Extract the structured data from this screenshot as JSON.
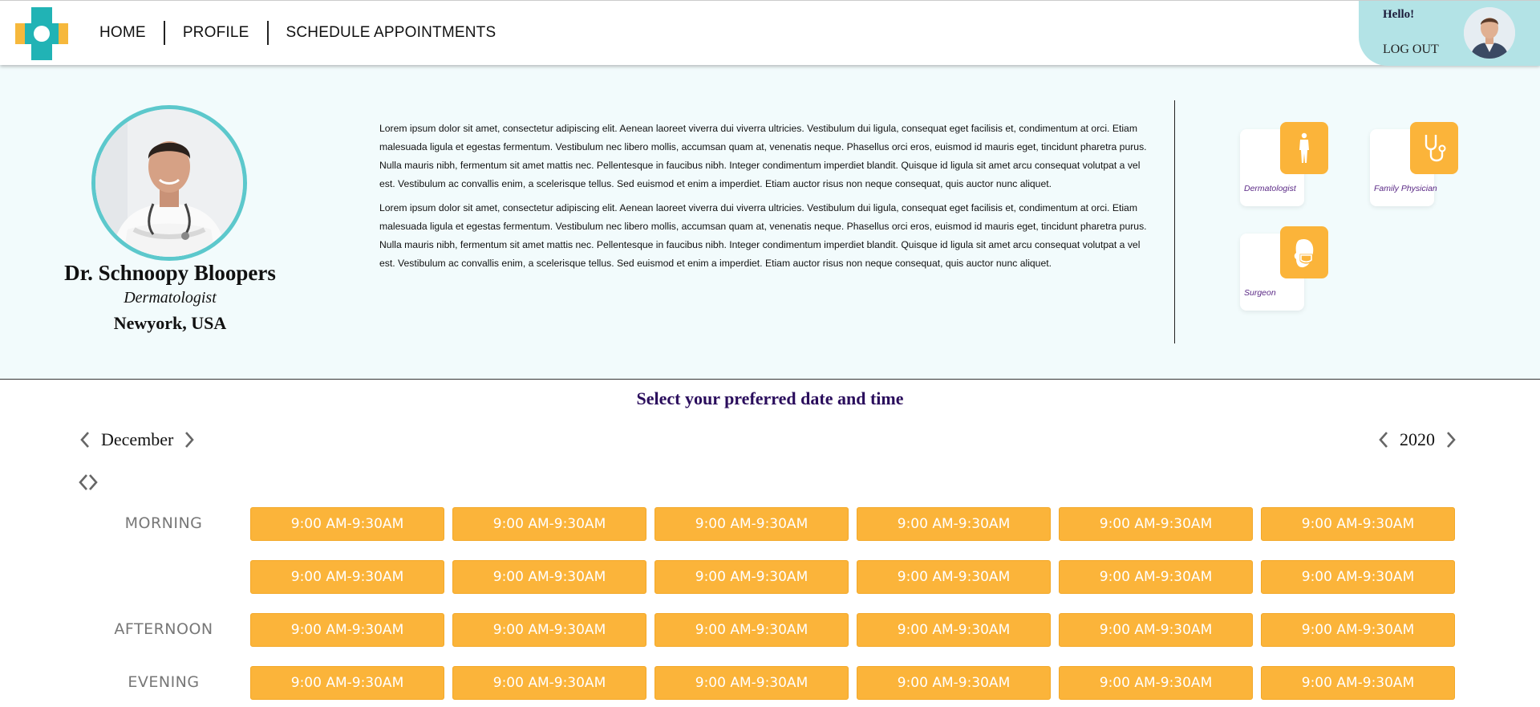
{
  "nav": {
    "links": [
      "HOME",
      "PROFILE",
      "SCHEDULE APPOINTMENTS"
    ]
  },
  "user": {
    "greeting": "Hello!",
    "logout_label": "LOG OUT"
  },
  "doctor": {
    "name": "Dr. Schnoopy Bloopers",
    "specialty": "Dermatologist",
    "location": "Newyork, USA"
  },
  "bio": {
    "paragraphs": [
      "Lorem ipsum dolor sit amet, consectetur adipiscing elit. Aenean laoreet viverra dui viverra ultricies. Vestibulum dui ligula, consequat eget facilisis et, condimentum at orci. Etiam malesuada ligula et egestas fermentum. Vestibulum nec libero mollis, accumsan quam at, venenatis neque. Phasellus orci eros, euismod id mauris eget, tincidunt pharetra purus. Nulla mauris nibh, fermentum sit amet mattis nec. Pellentesque in faucibus nibh. Integer condimentum imperdiet blandit. Quisque id ligula sit amet arcu consequat volutpat a vel est. Vestibulum ac convallis enim, a scelerisque tellus. Sed euismod et enim a imperdiet. Etiam auctor risus non neque consequat, quis auctor nunc aliquet.",
      "Lorem ipsum dolor sit amet, consectetur adipiscing elit. Aenean laoreet viverra dui viverra ultricies. Vestibulum dui ligula, consequat eget facilisis et, condimentum at orci. Etiam malesuada ligula et egestas fermentum. Vestibulum nec libero mollis, accumsan quam at, venenatis neque. Phasellus orci eros, euismod id mauris eget, tincidunt pharetra purus. Nulla mauris nibh, fermentum sit amet mattis nec. Pellentesque in faucibus nibh. Integer condimentum imperdiet blandit. Quisque id ligula sit amet arcu consequat volutpat a vel est. Vestibulum ac convallis enim, a scelerisque tellus. Sed euismod et enim a imperdiet. Etiam auctor risus non neque consequat, quis auctor nunc aliquet."
    ]
  },
  "specialties": [
    {
      "label": "Dermatologist",
      "icon": "human-body-icon"
    },
    {
      "label": "Family Physician",
      "icon": "stethoscope-icon"
    },
    {
      "label": "Surgeon",
      "icon": "surgeon-mask-icon"
    }
  ],
  "schedule": {
    "title": "Select your preferred date and time",
    "month": "December",
    "year": "2020",
    "periods": [
      {
        "label": "MORNING",
        "rows": [
          [
            "9:00 AM-9:30AM",
            "9:00 AM-9:30AM",
            "9:00 AM-9:30AM",
            "9:00 AM-9:30AM",
            "9:00 AM-9:30AM",
            "9:00 AM-9:30AM"
          ],
          [
            "9:00 AM-9:30AM",
            "9:00 AM-9:30AM",
            "9:00 AM-9:30AM",
            "9:00 AM-9:30AM",
            "9:00 AM-9:30AM",
            "9:00 AM-9:30AM"
          ]
        ]
      },
      {
        "label": "AFTERNOON",
        "rows": [
          [
            "9:00 AM-9:30AM",
            "9:00 AM-9:30AM",
            "9:00 AM-9:30AM",
            "9:00 AM-9:30AM",
            "9:00 AM-9:30AM",
            "9:00 AM-9:30AM"
          ]
        ]
      },
      {
        "label": "EVENING",
        "rows": [
          [
            "9:00 AM-9:30AM",
            "9:00 AM-9:30AM",
            "9:00 AM-9:30AM",
            "9:00 AM-9:30AM",
            "9:00 AM-9:30AM",
            "9:00 AM-9:30AM"
          ]
        ]
      }
    ]
  },
  "colors": {
    "accent": "#fbb43a",
    "teal": "#5cc8cc",
    "title_purple": "#2a0d5c",
    "section_bg": "#f2fbfc"
  }
}
